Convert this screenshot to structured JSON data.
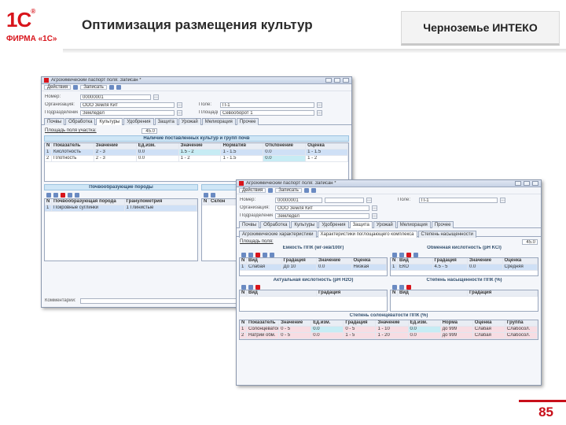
{
  "brand": {
    "mark": "1С",
    "registered": "®",
    "text": "ФИРМА «1С»"
  },
  "slide": {
    "title": "Оптимизация размещения культур",
    "company": "Черноземье ИНТЕКО",
    "page_number": "85"
  },
  "window1": {
    "title": "Агрохимический паспорт поля: Записан *",
    "toolbar": [
      "Действия",
      "Записать"
    ],
    "fields": [
      {
        "label": "Номер:",
        "value": "00000001"
      },
      {
        "label": "Организация:",
        "value": "ООО Земля Кит"
      },
      {
        "label": "Подразделение:",
        "value": "Земледел"
      },
      {
        "label": "Поле:",
        "value": "П-1"
      },
      {
        "label": "Площадь поля:",
        "value": "Севооборот 1"
      }
    ],
    "tabs": [
      "Почвы",
      "Обработка",
      "Культуры",
      "Удобрения",
      "Защита",
      "Урожай",
      "Мелиорация",
      "Прочее"
    ],
    "area": {
      "label": "Площадь поля участка:",
      "value": "45.0"
    },
    "section_title": "Наличие поставленных культур и групп почв",
    "table_headers": [
      "N",
      "Показатель",
      "Значение",
      "Ед.изм.",
      "Значение",
      "Норматив",
      "Отклонение",
      "Оценка"
    ],
    "table_rows": [
      [
        "1",
        "Кислотность",
        "2 - 3",
        "0.0",
        "1.5 - 2",
        "1 - 1.5",
        "0.0",
        "1 - 1.5"
      ],
      [
        "2",
        "Плотность",
        "2 - 3",
        "0.0",
        "1 - 2",
        "1 - 1.5",
        "0.0",
        "1 - 2"
      ]
    ],
    "soil": {
      "title": "Почвообразующие породы",
      "headers": [
        "N",
        "Почвообразующая порода",
        "Гранулометрия"
      ],
      "row": [
        "1",
        "Покровные суглинки",
        "1 Глинистые"
      ]
    },
    "soil2": {
      "title": "Склоны",
      "headers": [
        "N",
        "Склон"
      ]
    },
    "footer": "Комментарий:"
  },
  "window2": {
    "title": "Агрохимический паспорт поля: Записан *",
    "toolbar": [
      "Действия",
      "Записать"
    ],
    "fields": [
      {
        "label": "Номер:",
        "value": "00000001"
      },
      {
        "label": "Организация:",
        "value": "ООО Земля Кит"
      },
      {
        "label": "Подразделение:",
        "value": "Земледел"
      },
      {
        "label": "Поле:",
        "value": "П-1"
      }
    ],
    "tabs": [
      "Почвы",
      "Обработка",
      "Культуры",
      "Удобрения",
      "Защита",
      "Урожай",
      "Мелиорация",
      "Прочее"
    ],
    "subtabs": [
      "Агрохимические характеристики",
      "Характеристики поглощающего комплекса",
      "Степень насыщенности"
    ],
    "area": {
      "label": "Площадь поля:",
      "value": "45.0"
    },
    "panels": [
      {
        "title": "Ёмкость ППК (мг-экв/100г)",
        "headers": [
          "N",
          "Вид",
          "Градация",
          "Значение",
          "Оценка"
        ],
        "row": [
          "1",
          "Слабая",
          "До 10",
          "0.0",
          "Низкая"
        ]
      },
      {
        "title": "Обменная кислотность (pH KCl)",
        "headers": [
          "N",
          "Вид",
          "Градация",
          "Значение",
          "Оценка"
        ],
        "row": [
          "1",
          "ЕКО",
          "4.5 - 5",
          "0.0",
          "Средняя"
        ]
      },
      {
        "title": "Актуальная кислотность (pH H2O)",
        "headers": [
          "N",
          "Вид",
          "Градация"
        ]
      },
      {
        "title": "Степень насыщенности ППК (%)",
        "headers": [
          "N",
          "Вид",
          "Градация"
        ]
      }
    ],
    "bottom": {
      "title": "Степень солонцеватости ППК (%)",
      "headers": [
        "N",
        "Показатель",
        "Значение",
        "Ед.изм.",
        "Градация",
        "Значение",
        "Ед.изм.",
        "Норма",
        "Оценка",
        "Группа"
      ],
      "rows": [
        [
          "1",
          "Солонцеватость",
          "0 - 5",
          "0.0",
          "0 - 5",
          "1 - 10",
          "0.0",
          "до 999",
          "Слабая",
          "Слабосол."
        ],
        [
          "2",
          "Натрий обм.",
          "0 - 5",
          "0.0",
          "1 - 5",
          "1 - 20",
          "0.0",
          "до 999",
          "Слабая",
          "Слабосол."
        ]
      ]
    }
  }
}
